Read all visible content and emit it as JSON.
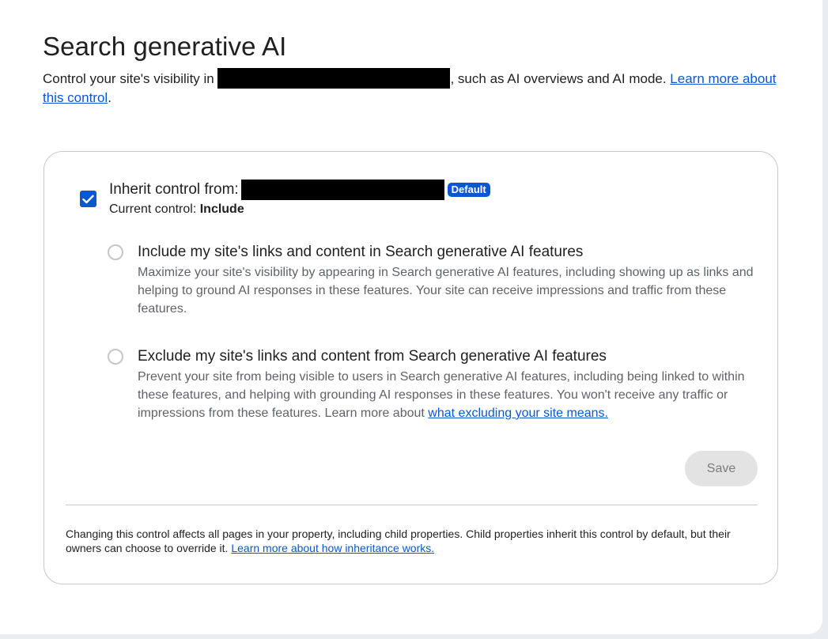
{
  "page": {
    "title": "Search generative AI",
    "intro_before": "Control your site's visibility in ",
    "intro_after": ", such as AI overviews and AI mode. ",
    "intro_link": "Learn more about this control",
    "intro_end": "."
  },
  "inherit": {
    "label": "Inherit control from:",
    "badge": "Default",
    "current_label": "Current control: ",
    "current_value": "Include",
    "checked": true
  },
  "options": {
    "include": {
      "title": "Include my site's links and content in Search generative AI features",
      "description": "Maximize your site's visibility by appearing in Search generative AI features, including showing up as links and helping to ground AI responses in these features. Your site can receive impressions and traffic from these features."
    },
    "exclude": {
      "title": "Exclude my site's links and content from Search generative AI features",
      "description": "Prevent your site from being visible to users in Search generative AI features, including being linked to within these features, and helping with grounding AI responses in these features. You won't receive any traffic or impressions from these features. Learn more about ",
      "link": "what excluding your site means."
    }
  },
  "actions": {
    "save_label": "Save"
  },
  "footer": {
    "text": "Changing this control affects all pages in your property, including child properties. Child properties inherit this control by default, but their owners can choose to override it. ",
    "link": "Learn more about how inheritance works."
  },
  "colors": {
    "accent": "#0b57d0",
    "text": "#1f1f1f",
    "secondary_text": "#5f6368",
    "border": "#c7c7c7"
  },
  "icons": {
    "checkbox": "check-icon"
  }
}
